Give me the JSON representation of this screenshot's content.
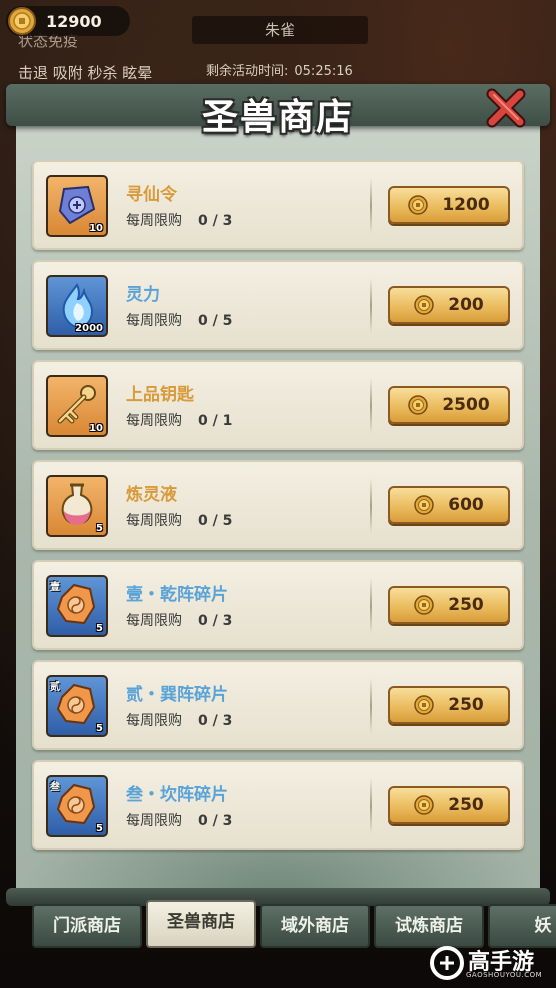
{
  "hud": {
    "coin_amount": "12900",
    "status_text": "状态免疫",
    "skills_text": "击退 吸附 秒杀 眩晕",
    "boss_name": "朱雀",
    "timer_label": "剩余活动时间:",
    "timer_value": "05:25:16"
  },
  "shop": {
    "title": "圣兽商店",
    "limit_label": "每周限购",
    "items": [
      {
        "name": "寻仙令",
        "name_color": "gold",
        "icon": "token-icon",
        "icon_bg": "orange",
        "count": "10",
        "corner": "",
        "limit": "0 / 3",
        "price": "1200"
      },
      {
        "name": "灵力",
        "name_color": "blue",
        "icon": "blue-flame-icon",
        "icon_bg": "blue",
        "count": "2000",
        "corner": "",
        "limit": "0 / 5",
        "price": "200"
      },
      {
        "name": "上品钥匙",
        "name_color": "gold",
        "icon": "key-icon",
        "icon_bg": "orange",
        "count": "10",
        "corner": "",
        "limit": "0 / 1",
        "price": "2500"
      },
      {
        "name": "炼灵液",
        "name_color": "gold",
        "icon": "potion-icon",
        "icon_bg": "orange",
        "count": "5",
        "corner": "",
        "limit": "0 / 5",
        "price": "600"
      },
      {
        "name": "壹・乾阵碎片",
        "name_color": "blue",
        "icon": "fragment-icon",
        "icon_bg": "blue",
        "count": "5",
        "corner": "壹",
        "limit": "0 / 3",
        "price": "250"
      },
      {
        "name": "贰・巽阵碎片",
        "name_color": "blue",
        "icon": "fragment-icon",
        "icon_bg": "blue",
        "count": "5",
        "corner": "贰",
        "limit": "0 / 3",
        "price": "250"
      },
      {
        "name": "叁・坎阵碎片",
        "name_color": "blue",
        "icon": "fragment-icon",
        "icon_bg": "blue",
        "count": "5",
        "corner": "叁",
        "limit": "0 / 3",
        "price": "250"
      }
    ]
  },
  "tabs": [
    {
      "label": "门派商店",
      "active": false
    },
    {
      "label": "圣兽商店",
      "active": true
    },
    {
      "label": "域外商店",
      "active": false
    },
    {
      "label": "试炼商店",
      "active": false
    },
    {
      "label": "妖",
      "active": false
    }
  ],
  "watermark": {
    "text": "高手游",
    "url": "GAOSHOUYOU.COM"
  },
  "colors": {
    "gold_name": "#d89a3a",
    "blue_name": "#5aa3d8",
    "button": "#e9b95a"
  }
}
